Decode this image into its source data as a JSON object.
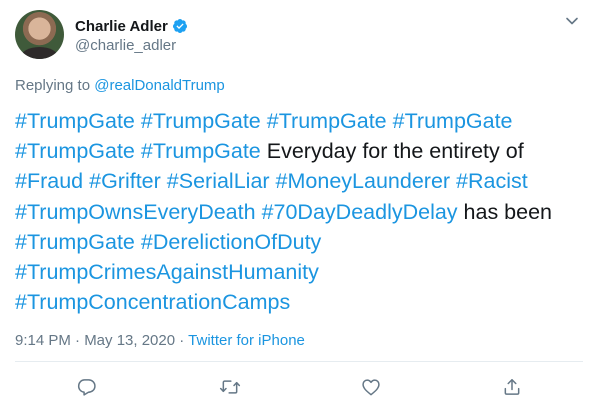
{
  "author": {
    "display_name": "Charlie Adler",
    "handle": "@charlie_adler",
    "avatar_icon": "user-photo"
  },
  "reply": {
    "prefix": "Replying to ",
    "mention": "@realDonaldTrump"
  },
  "tweet": {
    "segments": [
      {
        "text": "#TrumpGate",
        "tag": true
      },
      {
        "text": " ",
        "tag": false
      },
      {
        "text": "#TrumpGate",
        "tag": true
      },
      {
        "text": " ",
        "tag": false
      },
      {
        "text": "#TrumpGate",
        "tag": true
      },
      {
        "text": " ",
        "tag": false
      },
      {
        "text": "#TrumpGate",
        "tag": true
      },
      {
        "text": " ",
        "tag": false
      },
      {
        "text": "#TrumpGate",
        "tag": true
      },
      {
        "text": " ",
        "tag": false
      },
      {
        "text": "#TrumpGate",
        "tag": true
      },
      {
        "text": " Everyday for the entirety of ",
        "tag": false
      },
      {
        "text": "#Fraud",
        "tag": true
      },
      {
        "text": " ",
        "tag": false
      },
      {
        "text": "#Grifter",
        "tag": true
      },
      {
        "text": " ",
        "tag": false
      },
      {
        "text": "#SerialLiar",
        "tag": true
      },
      {
        "text": " ",
        "tag": false
      },
      {
        "text": "#MoneyLaunderer",
        "tag": true
      },
      {
        "text": " ",
        "tag": false
      },
      {
        "text": "#Racist",
        "tag": true
      },
      {
        "text": " ",
        "tag": false
      },
      {
        "text": "#TrumpOwnsEveryDeath",
        "tag": true
      },
      {
        "text": " ",
        "tag": false
      },
      {
        "text": "#70DayDeadlyDelay",
        "tag": true
      },
      {
        "text": " has been ",
        "tag": false
      },
      {
        "text": "#TrumpGate",
        "tag": true
      },
      {
        "text": " ",
        "tag": false
      },
      {
        "text": "#DerelictionOfDuty",
        "tag": true
      },
      {
        "text": " ",
        "tag": false
      },
      {
        "text": "#TrumpCrimesAgainstHumanity",
        "tag": true
      },
      {
        "text": " ",
        "tag": false
      },
      {
        "text": "#TrumpConcentrationCamps",
        "tag": true
      }
    ]
  },
  "meta": {
    "time_date": "9:14 PM · May 13, 2020 · ",
    "source": "Twitter for iPhone"
  },
  "actions": {
    "reply_icon": "reply-icon",
    "retweet_icon": "retweet-icon",
    "like_icon": "like-icon",
    "share_icon": "share-icon"
  },
  "colors": {
    "link": "#1b95e0",
    "muted": "#657786",
    "text": "#14171a",
    "verified": "#1da1f2"
  }
}
